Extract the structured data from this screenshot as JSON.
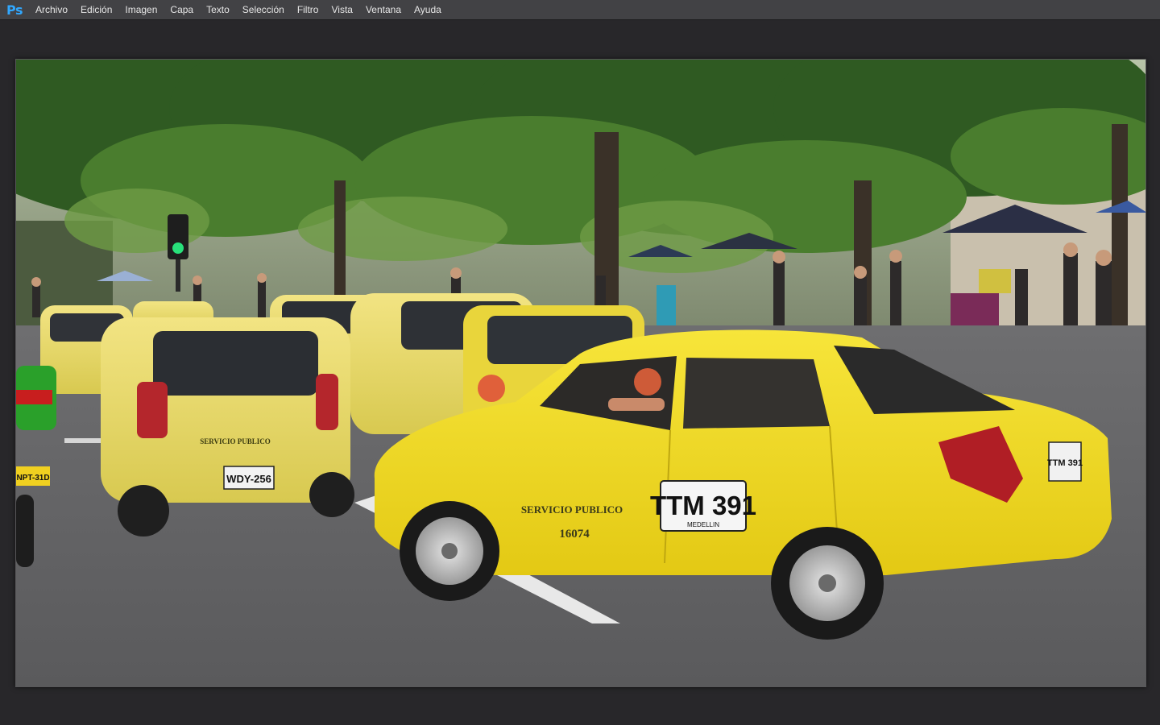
{
  "app": {
    "logo_text": "Ps",
    "accent_color": "#31a8ff"
  },
  "menubar": {
    "items": [
      {
        "label": "Archivo"
      },
      {
        "label": "Edición"
      },
      {
        "label": "Imagen"
      },
      {
        "label": "Capa"
      },
      {
        "label": "Texto"
      },
      {
        "label": "Selección"
      },
      {
        "label": "Filtro"
      },
      {
        "label": "Vista"
      },
      {
        "label": "Ventana"
      },
      {
        "label": "Ayuda"
      }
    ]
  },
  "document": {
    "photo": {
      "plate_main": "TTM 391",
      "plate_main_city": "MEDELLIN",
      "plate_left": "WDY-256",
      "plate_right": "TTM 391",
      "door_text": "SERVICIO PUBLICO",
      "door_number": "16074",
      "rear_text": "SERVICIO PUBLICO",
      "moto_plate": "NPT-31D",
      "taxi_color": "#f3e02a"
    }
  }
}
